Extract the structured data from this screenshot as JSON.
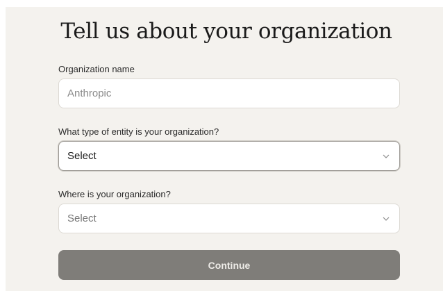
{
  "form": {
    "title": "Tell us about your organization",
    "org_name": {
      "label": "Organization name",
      "placeholder": "Anthropic"
    },
    "entity_type": {
      "label": "What type of entity is your organization?",
      "value": "Select"
    },
    "location": {
      "label": "Where is your organization?",
      "value": "Select"
    },
    "continue_label": "Continue"
  },
  "icons": {
    "select_chevron": "chevron-down-icon"
  },
  "colors": {
    "background": "#f4f2ee",
    "button": "#7f7d79",
    "field_border": "#dcd9d3"
  }
}
